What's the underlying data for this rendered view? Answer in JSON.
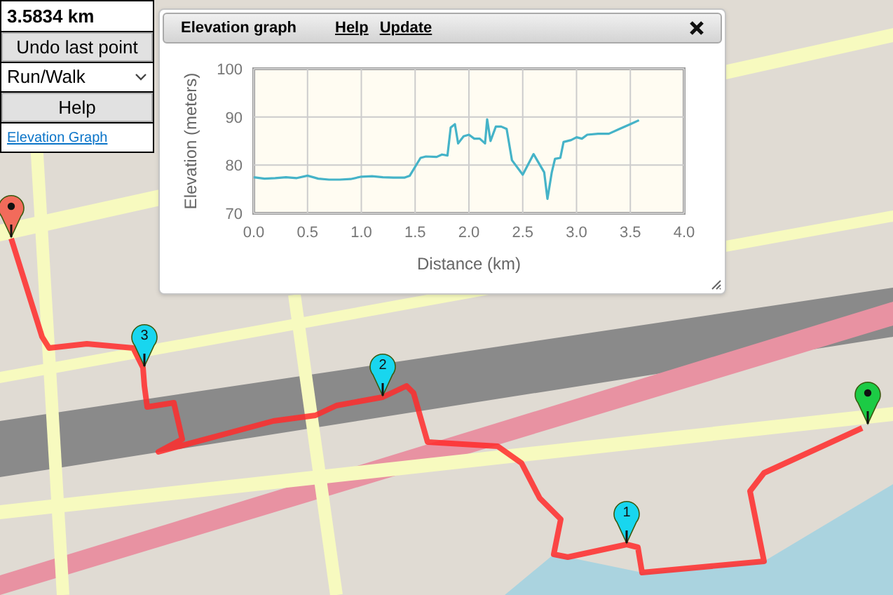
{
  "controls": {
    "distance": "3.5834 km",
    "undo_button": "Undo last point",
    "mode_select": "Run/Walk",
    "help_button": "Help",
    "graph_link": "Elevation Graph"
  },
  "map": {
    "route_markers": [
      {
        "kind": "endpoint",
        "color": "#f26b5b"
      },
      {
        "kind": "numbered",
        "label": "3",
        "color": "#18d6ef"
      },
      {
        "kind": "numbered",
        "label": "2",
        "color": "#18d6ef"
      },
      {
        "kind": "numbered",
        "label": "1",
        "color": "#18d6ef"
      },
      {
        "kind": "endpoint",
        "color": "#1ccb45"
      }
    ]
  },
  "elevation_window": {
    "title": "Elevation graph",
    "links": [
      "Help",
      "Update"
    ],
    "chart_data": {
      "type": "line",
      "xlabel": "Distance (km)",
      "ylabel": "Elevation (meters)",
      "x": [
        0,
        0.1,
        0.2,
        0.3,
        0.4,
        0.5,
        0.6,
        0.7,
        0.8,
        0.9,
        1.0,
        1.1,
        1.2,
        1.3,
        1.4,
        1.45,
        1.55,
        1.6,
        1.7,
        1.75,
        1.8,
        1.83,
        1.87,
        1.9,
        1.95,
        2.0,
        2.05,
        2.1,
        2.15,
        2.17,
        2.2,
        2.25,
        2.3,
        2.35,
        2.4,
        2.5,
        2.6,
        2.7,
        2.73,
        2.77,
        2.8,
        2.85,
        2.88,
        2.95,
        3.0,
        3.05,
        3.1,
        3.2,
        3.3,
        3.4,
        3.5,
        3.58
      ],
      "grid": true,
      "series": [
        {
          "color": "#45b3c8",
          "values": [
            77.5,
            77.2,
            77.3,
            77.5,
            77.3,
            77.8,
            77.2,
            77.0,
            77.0,
            77.1,
            77.6,
            77.7,
            77.5,
            77.4,
            77.4,
            77.8,
            81.5,
            81.8,
            81.7,
            82.2,
            82.0,
            87.8,
            88.5,
            84.5,
            86.0,
            86.3,
            85.5,
            85.5,
            84.5,
            89.5,
            85.0,
            88.0,
            88.0,
            87.5,
            81.0,
            78.0,
            82.3,
            78.5,
            73.0,
            78.5,
            81.3,
            81.5,
            84.8,
            85.2,
            85.8,
            85.5,
            86.3,
            86.5,
            86.5,
            87.5,
            88.5,
            89.3
          ]
        }
      ],
      "xlim": [
        0,
        4
      ],
      "ylim": [
        70,
        100
      ],
      "xticks": [
        {
          "value": 0,
          "label": "0.0"
        },
        {
          "value": 0.5,
          "label": "0.5"
        },
        {
          "value": 1,
          "label": "1.0"
        },
        {
          "value": 1.5,
          "label": "1.5"
        },
        {
          "value": 2,
          "label": "2.0"
        },
        {
          "value": 2.5,
          "label": "2.5"
        },
        {
          "value": 3,
          "label": "3.0"
        },
        {
          "value": 3.5,
          "label": "3.5"
        },
        {
          "value": 4,
          "label": "4.0"
        }
      ],
      "yticks": [
        70,
        80,
        90,
        100
      ]
    }
  }
}
